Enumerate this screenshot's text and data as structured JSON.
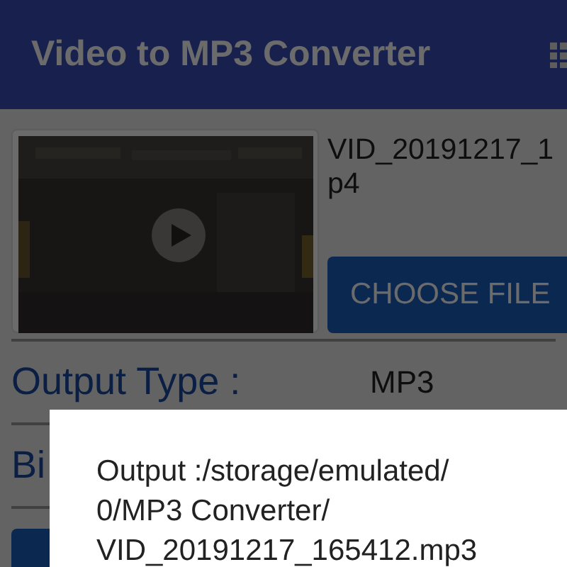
{
  "app_bar": {
    "title": "Video to MP3 Converter"
  },
  "file": {
    "name_lines": [
      "VID_20191217_1",
      "p4"
    ],
    "button": "CHOOSE FILE"
  },
  "fields": [
    {
      "label": "Output Type :",
      "value": "MP3"
    },
    {
      "label": "Bi"
    }
  ],
  "dialog": {
    "message_lines": [
      "Output :/storage/emulated/",
      "0/MP3 Converter/",
      "VID_20191217_165412.mp3"
    ]
  }
}
